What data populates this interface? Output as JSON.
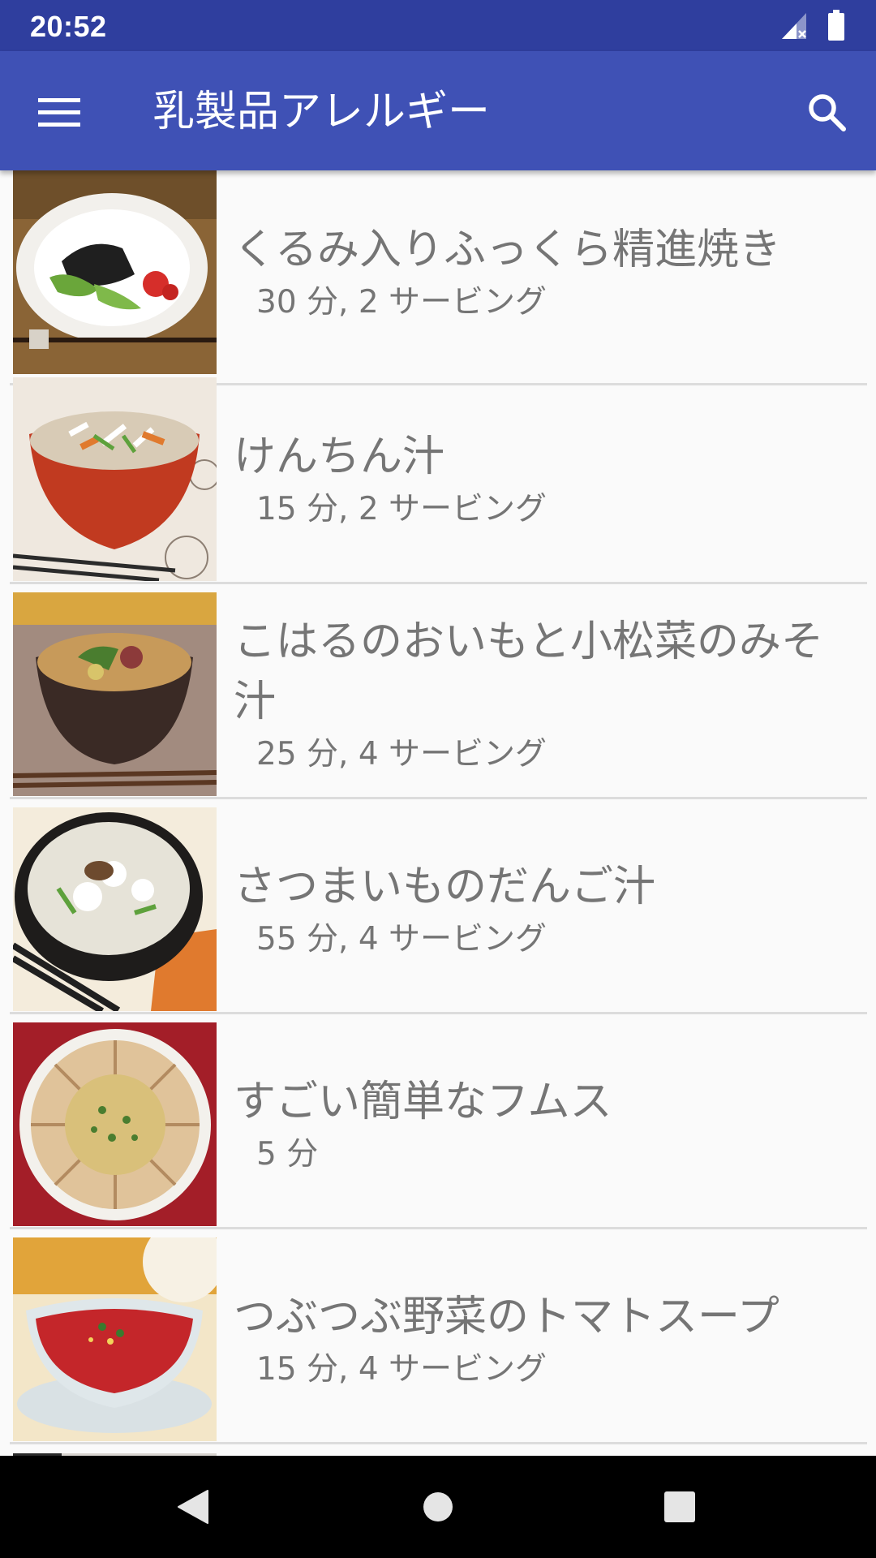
{
  "status_bar": {
    "time": "20:52",
    "icons": [
      "signal-icon",
      "battery-icon"
    ]
  },
  "app_bar": {
    "title": "乳製品アレルギー",
    "menu_icon": "menu-icon",
    "search_icon": "search-icon",
    "color": "#3f51b5",
    "status_color": "#2f3e9e"
  },
  "recipes": [
    {
      "title": "くるみ入りふっくら精進焼き",
      "meta": "30 分, 2 サービング"
    },
    {
      "title": "けんちん汁",
      "meta": "15 分, 2 サービング"
    },
    {
      "title": "こはるのおいもと小松菜のみそ汁",
      "meta": "25 分, 4 サービング"
    },
    {
      "title": "さつまいものだんご汁",
      "meta": "55 分, 4 サービング"
    },
    {
      "title": "すごい簡単なフムス",
      "meta": "5 分"
    },
    {
      "title": "つぶつぶ野菜のトマトスープ",
      "meta": "15 分, 4 サービング"
    }
  ],
  "nav_bar": {
    "back_icon": "back-icon",
    "home_icon": "home-icon",
    "recents_icon": "recents-icon"
  }
}
